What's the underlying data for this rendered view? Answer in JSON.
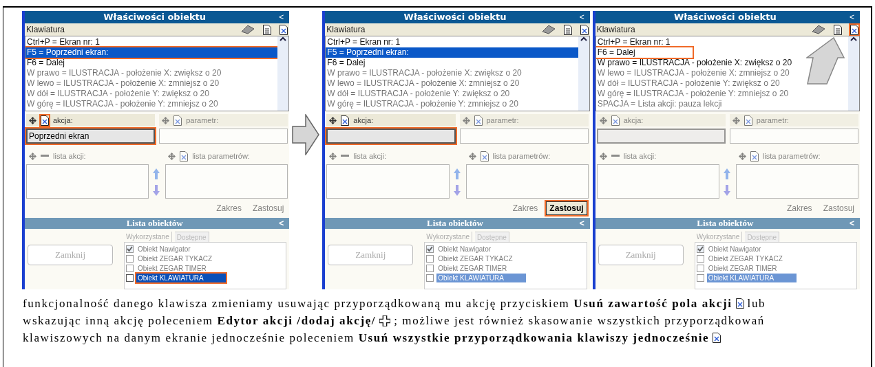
{
  "panels": [
    {
      "title": "Właściwości obiektu",
      "collapse": "<",
      "section": "Klawiatura",
      "delete_all_highlighted": false,
      "keys": [
        {
          "text": "Ctrl+P = Ekran nr: 1",
          "selected": false,
          "dimmed": false,
          "highlighted": false
        },
        {
          "text": "F5 = Poprzedni ekran:",
          "selected": true,
          "dimmed": false,
          "highlighted": true
        },
        {
          "text": "F6 = Dalej",
          "selected": false,
          "dimmed": false,
          "highlighted": false
        },
        {
          "text": "W prawo = ILUSTRACJA - położenie X: zwiększ o 20",
          "selected": false,
          "dimmed": true,
          "highlighted": false
        },
        {
          "text": "W lewo = ILUSTRACJA - położenie X: zmniejsz o 20",
          "selected": false,
          "dimmed": true,
          "highlighted": false
        },
        {
          "text": "W dół = ILUSTRACJA - położenie Y: zwiększ o 20",
          "selected": false,
          "dimmed": true,
          "highlighted": false
        },
        {
          "text": "W górę = ILUSTRACJA - położenie Y: zmniejsz o 20",
          "selected": false,
          "dimmed": true,
          "highlighted": false
        }
      ],
      "action": {
        "label": "akcja:",
        "value": "Poprzedni ekran",
        "dimmed": false,
        "highlighted": true,
        "icon_highlighted": true
      },
      "parameter": {
        "label": "parametr:",
        "dimmed": true
      },
      "action_list": {
        "label": "lista akcji:",
        "dimmed": true
      },
      "parameter_list": {
        "label": "lista parametrów:",
        "dimmed": true
      },
      "buttons": [
        {
          "label": "Zakres",
          "dimmed": true,
          "highlighted": false
        },
        {
          "label": "Zastosuj",
          "dimmed": true,
          "highlighted": false
        }
      ],
      "objects_title": "Lista obiektów",
      "tabs": [
        {
          "label": "Wykorzystane",
          "selected": true
        },
        {
          "label": "Dostępne",
          "selected": false
        }
      ],
      "close": "Zamknij",
      "objects": [
        {
          "text": "Obiekt Nawigator",
          "checked": true,
          "selected": false,
          "dimmed": true,
          "highlighted": false
        },
        {
          "text": "Obiekt ZEGAR TYKACZ",
          "checked": false,
          "selected": false,
          "dimmed": true,
          "highlighted": false
        },
        {
          "text": "Obiekt ZEGAR TIMER",
          "checked": false,
          "selected": false,
          "dimmed": true,
          "highlighted": false
        },
        {
          "text": "Obiekt KLAWIATURA",
          "checked": false,
          "selected": true,
          "dimmed": false,
          "highlighted": true
        }
      ]
    },
    {
      "title": "Właściwości obiektu",
      "collapse": "<",
      "section": "Klawiatura",
      "delete_all_highlighted": false,
      "keys": [
        {
          "text": "Ctrl+P = Ekran nr: 1",
          "selected": false,
          "dimmed": false,
          "highlighted": false
        },
        {
          "text": "F5 = Poprzedni ekran:",
          "selected": true,
          "dimmed": false,
          "highlighted": false
        },
        {
          "text": "F6 = Dalej",
          "selected": false,
          "dimmed": false,
          "highlighted": false
        },
        {
          "text": "W prawo = ILUSTRACJA - położenie X: zwiększ o 20",
          "selected": false,
          "dimmed": true,
          "highlighted": false
        },
        {
          "text": "W lewo = ILUSTRACJA - położenie X: zmniejsz o 20",
          "selected": false,
          "dimmed": true,
          "highlighted": false
        },
        {
          "text": "W dół = ILUSTRACJA - położenie Y: zwiększ o 20",
          "selected": false,
          "dimmed": true,
          "highlighted": false
        },
        {
          "text": "W górę = ILUSTRACJA - położenie Y: zmniejsz o 20",
          "selected": false,
          "dimmed": true,
          "highlighted": false
        }
      ],
      "action": {
        "label": "akcja:",
        "dimmed": false,
        "highlighted": true,
        "icon_highlighted": false
      },
      "parameter": {
        "label": "parametr:",
        "dimmed": true
      },
      "action_list": {
        "label": "lista akcji:",
        "dimmed": true
      },
      "parameter_list": {
        "label": "lista parametrów:",
        "dimmed": true
      },
      "buttons": [
        {
          "label": "Zakres",
          "dimmed": true,
          "highlighted": false
        },
        {
          "label": "Zastosuj",
          "dimmed": false,
          "highlighted": true
        }
      ],
      "objects_title": "Lista obiektów",
      "tabs": [
        {
          "label": "Wykorzystane",
          "selected": true
        },
        {
          "label": "Dostępne",
          "selected": false
        }
      ],
      "close": "Zamknij",
      "objects": [
        {
          "text": "Obiekt Nawigator",
          "checked": true,
          "selected": false,
          "dimmed": true,
          "highlighted": false
        },
        {
          "text": "Obiekt ZEGAR TYKACZ",
          "checked": false,
          "selected": false,
          "dimmed": true,
          "highlighted": false
        },
        {
          "text": "Obiekt ZEGAR TIMER",
          "checked": false,
          "selected": false,
          "dimmed": true,
          "highlighted": false
        },
        {
          "text": "Obiekt KLAWIATURA",
          "checked": false,
          "selected": true,
          "dimmed": true,
          "highlighted": false
        }
      ]
    },
    {
      "title": "Właściwości obiektu",
      "collapse": "<",
      "section": "Klawiatura",
      "delete_all_highlighted": true,
      "keys": [
        {
          "text": "Ctrl+P = Ekran nr: 1",
          "selected": false,
          "dimmed": false,
          "highlighted": false
        },
        {
          "text": "F6 = Dalej",
          "selected": false,
          "dimmed": false,
          "highlighted": true
        },
        {
          "text": "W prawo = ILUSTRACJA - położenie X: zwiększ o 20",
          "selected": false,
          "dimmed": false,
          "highlighted": false
        },
        {
          "text": "W lewo = ILUSTRACJA - położenie X: zmniejsz o 20",
          "selected": false,
          "dimmed": true,
          "highlighted": false
        },
        {
          "text": "W dół = ILUSTRACJA - położenie Y: zwiększ o 20",
          "selected": false,
          "dimmed": true,
          "highlighted": false
        },
        {
          "text": "W górę = ILUSTRACJA - położenie Y: zmniejsz o 20",
          "selected": false,
          "dimmed": true,
          "highlighted": false
        },
        {
          "text": "SPACJA = Lista akcji: pauza lekcji",
          "selected": false,
          "dimmed": true,
          "highlighted": false
        }
      ],
      "action": {
        "label": "akcja:",
        "dimmed": true,
        "highlighted": false,
        "icon_highlighted": false
      },
      "parameter": {
        "label": "parametr:",
        "dimmed": true
      },
      "action_list": {
        "label": "lista akcji:",
        "dimmed": true
      },
      "parameter_list": {
        "label": "lista parametrów:",
        "dimmed": true
      },
      "buttons": [
        {
          "label": "Zakres",
          "dimmed": true,
          "highlighted": false
        },
        {
          "label": "Zastosuj",
          "dimmed": true,
          "highlighted": false
        }
      ],
      "objects_title": "Lista obiektów",
      "tabs": [
        {
          "label": "Wykorzystane",
          "selected": true
        },
        {
          "label": "Dostępne",
          "selected": false
        }
      ],
      "close": "Zamknij",
      "objects": [
        {
          "text": "Obiekt Nawigator",
          "checked": true,
          "selected": false,
          "dimmed": true,
          "highlighted": false
        },
        {
          "text": "Obiekt ZEGAR TYKACZ",
          "checked": false,
          "selected": false,
          "dimmed": true,
          "highlighted": false
        },
        {
          "text": "Obiekt ZEGAR TIMER",
          "checked": false,
          "selected": false,
          "dimmed": true,
          "highlighted": false
        },
        {
          "text": "Obiekt KLAWIATURA",
          "checked": false,
          "selected": true,
          "dimmed": true,
          "highlighted": false
        }
      ]
    }
  ],
  "paragraph": [
    [
      {
        "kind": "text",
        "text": "funkcjonalność danego klawisza zmieniamy usuwając przyporządkowaną mu akcję przyciskiem **Usuń zawartość pola akcji**"
      },
      {
        "kind": "delete_icon"
      },
      {
        "kind": "text",
        "text": "lub"
      }
    ],
    [
      {
        "kind": "text",
        "text": "wskazując inną akcję poleceniem **Edytor akcji /dodaj akcję/**"
      },
      {
        "kind": "add_icon"
      },
      {
        "kind": "text",
        "text": "; możliwe jest również skasowanie wszystkich przyporządkowań"
      }
    ],
    [
      {
        "kind": "text",
        "text": "klawiszowych na danym ekranie jednocześnie poleceniem **Usuń wszystkie przyporządkowania klawiszy jednocześnie**"
      },
      {
        "kind": "delete_icon"
      }
    ]
  ]
}
